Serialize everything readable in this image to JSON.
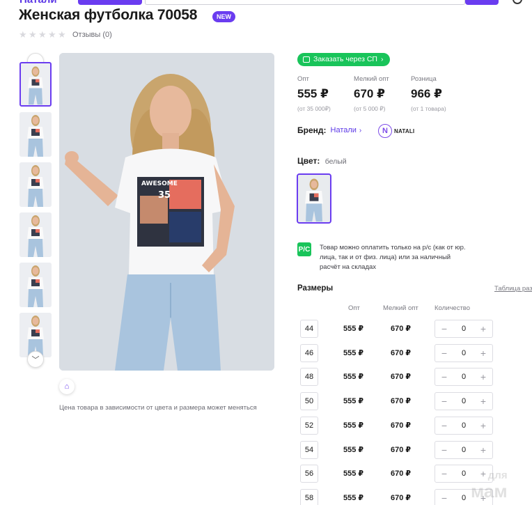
{
  "header": {
    "logo_fragment": "Натали"
  },
  "product": {
    "title": "Женская футболка 70058",
    "badge": "NEW",
    "reviews": "Отзывы (0)",
    "rating_stars": 0
  },
  "gallery": {
    "thumbnails_count": 6,
    "active_index": 0,
    "price_note": "Цена товара в зависимости от цвета и размера может меняться"
  },
  "sp_button": "Заказать через СП",
  "prices": [
    {
      "label": "Опт",
      "value": "555 ₽",
      "min": "(от 35 000₽)"
    },
    {
      "label": "Мелкий опт",
      "value": "670 ₽",
      "min": "(от 5 000 ₽)"
    },
    {
      "label": "Розница",
      "value": "966 ₽",
      "min": "(от 1 товара)"
    }
  ],
  "brand": {
    "label": "Бренд:",
    "name": "Натали",
    "logo_letter": "N",
    "logo_text": "NATALI"
  },
  "color": {
    "label": "Цвет:",
    "value": "белый"
  },
  "payment_note": {
    "icon_text": "Р/С",
    "text": "Товар можно оплатить только на р/с (как от юр. лица, так и от физ. лица) или за наличный расчёт на складах"
  },
  "sizes": {
    "title": "Размеры",
    "table_link": "Таблица раз",
    "headers": {
      "opt": "Опт",
      "small_opt": "Мелкий опт",
      "qty": "Количество"
    },
    "rows": [
      {
        "size": "44",
        "opt": "555 ₽",
        "small": "670 ₽",
        "qty": "0"
      },
      {
        "size": "46",
        "opt": "555 ₽",
        "small": "670 ₽",
        "qty": "0"
      },
      {
        "size": "48",
        "opt": "555 ₽",
        "small": "670 ₽",
        "qty": "0"
      },
      {
        "size": "50",
        "opt": "555 ₽",
        "small": "670 ₽",
        "qty": "0"
      },
      {
        "size": "52",
        "opt": "555 ₽",
        "small": "670 ₽",
        "qty": "0"
      },
      {
        "size": "54",
        "opt": "555 ₽",
        "small": "670 ₽",
        "qty": "0"
      },
      {
        "size": "56",
        "opt": "555 ₽",
        "small": "670 ₽",
        "qty": "0"
      },
      {
        "size": "58",
        "opt": "555 ₽",
        "small": "670 ₽",
        "qty": "0"
      }
    ]
  },
  "watermark": {
    "top": "для",
    "bottom": "мам"
  },
  "colors": {
    "accent": "#6a3cf0",
    "green": "#19c45a",
    "photo_bg": "#d8dde3"
  }
}
